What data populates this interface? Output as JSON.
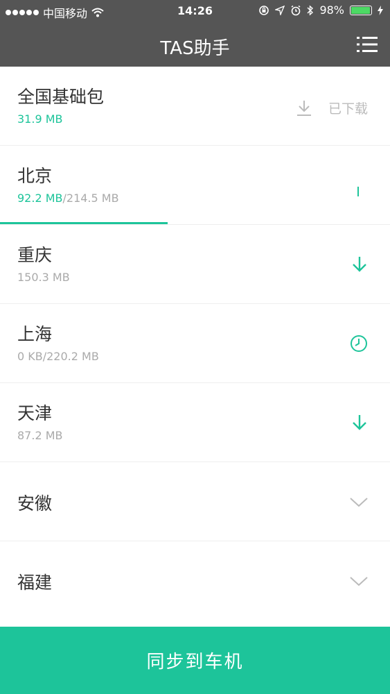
{
  "status_bar": {
    "carrier": "中国移动",
    "time": "14:26",
    "battery": "98%",
    "battery_level": 0.98
  },
  "header": {
    "title": "TAS助手",
    "menu_icon": "list-menu-icon"
  },
  "regions": [
    {
      "name": "全国基础包",
      "size_done": "31.9 MB",
      "size_total": "",
      "status": "downloaded",
      "status_label": "已下载"
    },
    {
      "name": "北京",
      "size_done": "92.2 MB",
      "size_total": "/214.5 MB",
      "status": "downloading",
      "progress": 0.43
    },
    {
      "name": "重庆",
      "size_done": "",
      "size_total": "150.3 MB",
      "status": "download"
    },
    {
      "name": "上海",
      "size_done": "",
      "size_total": "0 KB/220.2 MB",
      "status": "waiting"
    },
    {
      "name": "天津",
      "size_done": "",
      "size_total": "87.2 MB",
      "status": "download"
    },
    {
      "name": "安徽",
      "status": "expand"
    },
    {
      "name": "福建",
      "status": "expand"
    }
  ],
  "colors": {
    "accent": "#1dc49a",
    "header_bg": "#555555"
  },
  "footer": {
    "sync_label": "同步到车机"
  }
}
